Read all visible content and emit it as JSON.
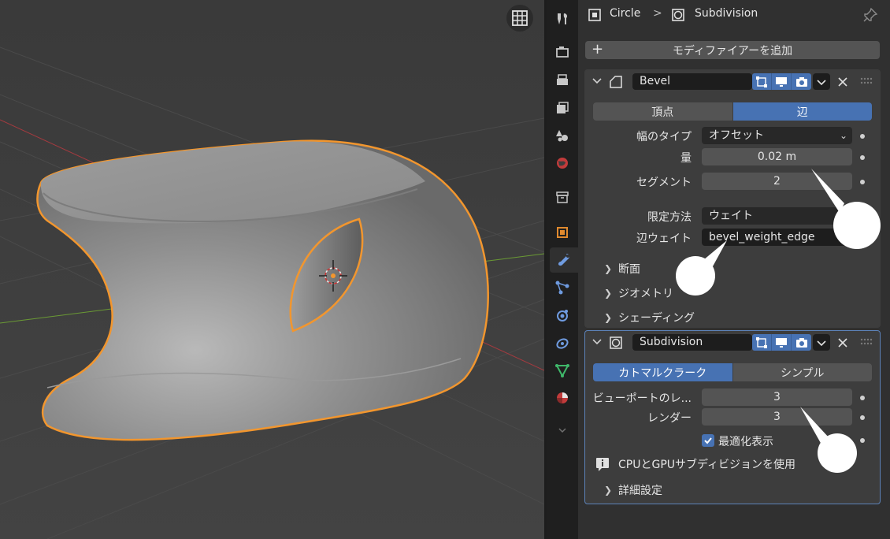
{
  "breadcrumb": {
    "object_name": "Circle",
    "modifier_name": "Subdivision",
    "separator": ">"
  },
  "add_modifier_label": "モディファイアーを追加",
  "add_modifier_plus": "+",
  "bevel": {
    "name": "Bevel",
    "affect_tabs": [
      "頂点",
      "辺"
    ],
    "affect_active": "辺",
    "width_type_label": "幅のタイプ",
    "width_type_value": "オフセット",
    "amount_label": "量",
    "amount_value": "0.02 m",
    "segments_label": "セグメント",
    "segments_value": "2",
    "limit_method_label": "限定方法",
    "limit_method_value": "ウェイト",
    "edge_weight_label": "辺ウェイト",
    "edge_weight_value": "bevel_weight_edge",
    "profile_label": "断面",
    "geometry_label": "ジオメトリ",
    "shading_label": "シェーディング"
  },
  "subdivision": {
    "name": "Subdivision",
    "mode_tabs": [
      "カトマルクラーク",
      "シンプル"
    ],
    "mode_active": "カトマルクラーク",
    "viewport_label": "ビューポートのレ...",
    "viewport_value": "3",
    "render_label": "レンダー",
    "render_value": "3",
    "optimal_display_label": "最適化表示",
    "optimal_display_checked": true,
    "gpu_info": "CPUとGPUサブディビジョンを使用",
    "advanced_label": "詳細設定"
  },
  "property_tabs": [
    "tool-icon",
    "render-icon",
    "output-icon",
    "view-layer-icon",
    "scene-icon",
    "world-icon",
    "collection-icon",
    "object-icon",
    "modifier-icon",
    "particles-icon",
    "physics-icon",
    "constraints-icon",
    "data-icon",
    "material-icon",
    "expand-icon"
  ],
  "active_tab": "modifier-icon",
  "colors": {
    "accent": "#4772b3",
    "selection_outline": "#f2962e",
    "panel_bg": "#303030",
    "viewport_bg": "#3d3d3d"
  }
}
